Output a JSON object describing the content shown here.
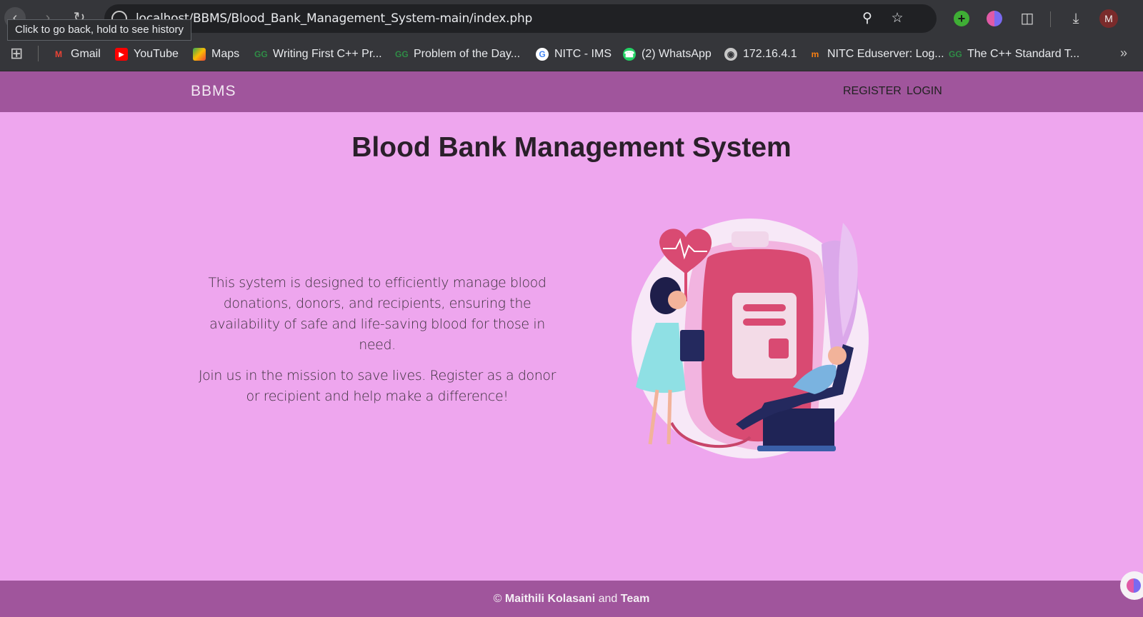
{
  "browser": {
    "url": "localhost/BBMS/Blood_Bank_Management_System-main/index.php",
    "tooltip": "Click to go back, hold to see history",
    "profile_initial": "M",
    "bookmarks": [
      {
        "label": "Gmail",
        "icon": "gmail-icon",
        "color": "#ea4335"
      },
      {
        "label": "YouTube",
        "icon": "youtube-icon",
        "color": "#ff0000"
      },
      {
        "label": "Maps",
        "icon": "maps-icon",
        "color": "#34a853"
      },
      {
        "label": "Writing First C++ Pr...",
        "icon": "gfg-icon",
        "color": "#2f8d46"
      },
      {
        "label": "Problem of the Day...",
        "icon": "gfg-icon",
        "color": "#2f8d46"
      },
      {
        "label": "NITC - IMS",
        "icon": "google-icon",
        "color": "#4285f4"
      },
      {
        "label": "(2) WhatsApp",
        "icon": "whatsapp-icon",
        "color": "#25d366"
      },
      {
        "label": "172.16.4.1",
        "icon": "globe-icon",
        "color": "#c8c8c8"
      },
      {
        "label": "NITC Eduserver: Log...",
        "icon": "moodle-icon",
        "color": "#f98012"
      },
      {
        "label": "The C++ Standard T...",
        "icon": "gfg-icon",
        "color": "#2f8d46"
      }
    ]
  },
  "nav": {
    "brand": "BBMS",
    "register": "REGISTER",
    "login": "LOGIN"
  },
  "main": {
    "title": "Blood Bank Management System",
    "paragraph1": "This system is designed to efficiently manage blood donations, donors, and recipients, ensuring the availability of safe and life-saving blood for those in need.",
    "paragraph2": "Join us in the mission to save lives. Register as a donor or recipient and help make a difference!"
  },
  "footer": {
    "copyright": "©",
    "author": "Maithili Kolasani",
    "conjunction": "and",
    "team": "Team"
  },
  "colors": {
    "page_background": "#eea6ee",
    "navbar": "#a0559c",
    "blood_bag": "#d94a72"
  }
}
